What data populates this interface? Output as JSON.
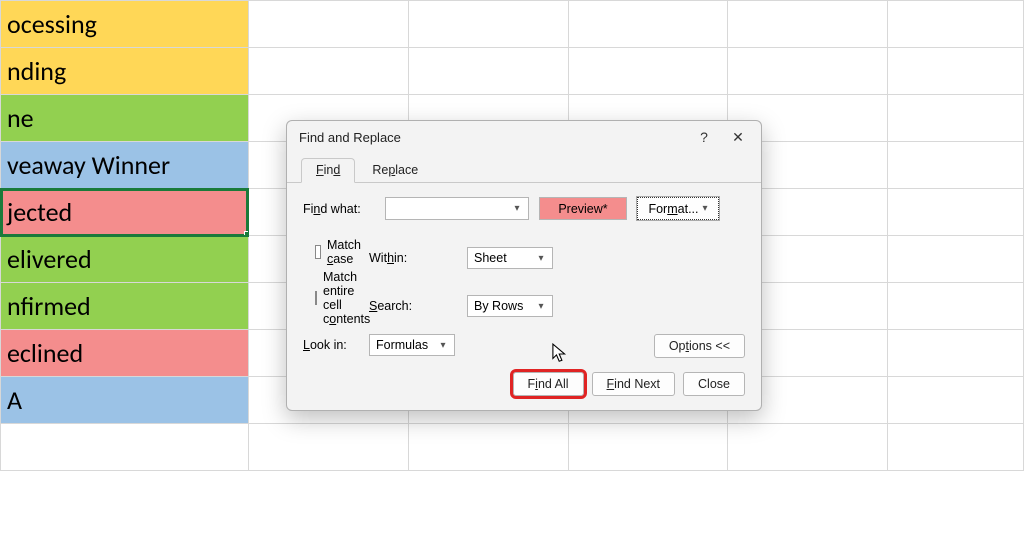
{
  "cells": [
    {
      "text": "ocessing",
      "cls": "yellow"
    },
    {
      "text": "nding",
      "cls": "yellow"
    },
    {
      "text": "ne",
      "cls": "green"
    },
    {
      "text": "veaway Winner",
      "cls": "blue"
    },
    {
      "text": "jected",
      "cls": "pink",
      "selected": true
    },
    {
      "text": "elivered",
      "cls": "green"
    },
    {
      "text": "nfirmed",
      "cls": "green"
    },
    {
      "text": "eclined",
      "cls": "pink"
    },
    {
      "text": "A",
      "cls": "blue"
    },
    {
      "text": "",
      "cls": ""
    }
  ],
  "dialog": {
    "title": "Find and Replace",
    "tabs": {
      "find": "Find",
      "replace": "Replace"
    },
    "find_what_label": "Find what:",
    "find_value": "",
    "preview_text": "Preview*",
    "format_label": "Format...",
    "within_label": "Within:",
    "within_value": "Sheet",
    "search_label": "Search:",
    "search_value": "By Rows",
    "lookin_label": "Look in:",
    "lookin_value": "Formulas",
    "match_case": "Match case",
    "match_entire": "Match entire cell contents",
    "options_label": "Options <<",
    "find_all": "Find All",
    "find_next": "Find Next",
    "close": "Close",
    "help": "?",
    "x": "✕"
  }
}
